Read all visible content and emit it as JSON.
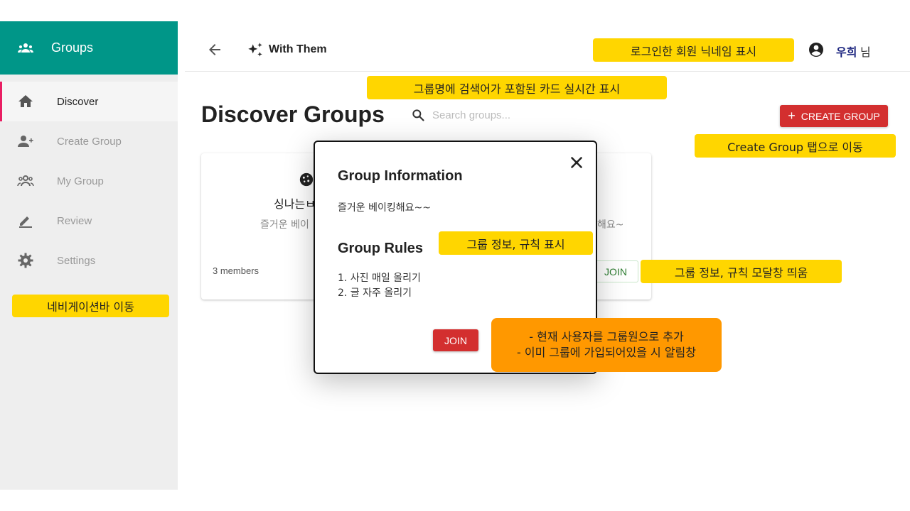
{
  "sidebar": {
    "title": "Groups",
    "title_icon": "groups-icon",
    "items": [
      {
        "label": "Discover",
        "icon": "home-icon",
        "active": true
      },
      {
        "label": "Create Group",
        "icon": "person-add-icon",
        "active": false
      },
      {
        "label": "My Group",
        "icon": "group-icon",
        "active": false
      },
      {
        "label": "Review",
        "icon": "edit-icon",
        "active": false
      },
      {
        "label": "Settings",
        "icon": "gear-icon",
        "active": false
      }
    ]
  },
  "topbar": {
    "back_icon": "arrow-left-icon",
    "brand_icon": "sparkle-icon",
    "brand": "With Them",
    "user_icon": "account-circle-icon",
    "user_name": "우희",
    "user_suffix": "님"
  },
  "main": {
    "title": "Discover Groups",
    "search": {
      "placeholder": "Search groups..."
    },
    "create_button": "CREATE GROUP"
  },
  "cards": [
    {
      "name_partial": "싱나는ㅂ",
      "desc_partial": "즐거운 베이",
      "members": "3 members"
    },
    {
      "desc_partial": "해요~",
      "join_label": "JOIN"
    }
  ],
  "modal": {
    "info_title": "Group Information",
    "info_desc": "즐거운 베이킹해요~~",
    "rules_title": "Group Rules",
    "rules": [
      "1. 사진 매일 올리기",
      "2. 글 자주 올리기"
    ],
    "join_label": "JOIN"
  },
  "annotations": {
    "nickname": "로그인한 회원 닉네임 표시",
    "search": "그룹명에 검색어가 포함된 카드 실시간 표시",
    "create_tab": "Create Group 탭으로 이동",
    "navbar": "네비게이션바 이동",
    "info_rules": "그룹 정보, 규칙 표시",
    "modal_open": "그룹 정보, 규칙 모달창 띄움",
    "join_line1": "- 현재 사용자를 그룹원으로 추가",
    "join_line2": "- 이미 그룹에 가입되어있을 시 알림창"
  },
  "colors": {
    "sidebar_header": "#009688",
    "accent_red": "#d32f2f",
    "annotation_yellow": "#ffd600",
    "annotation_orange": "#ff9800",
    "active_indicator": "#e91e63",
    "user_name": "#1a237e"
  }
}
